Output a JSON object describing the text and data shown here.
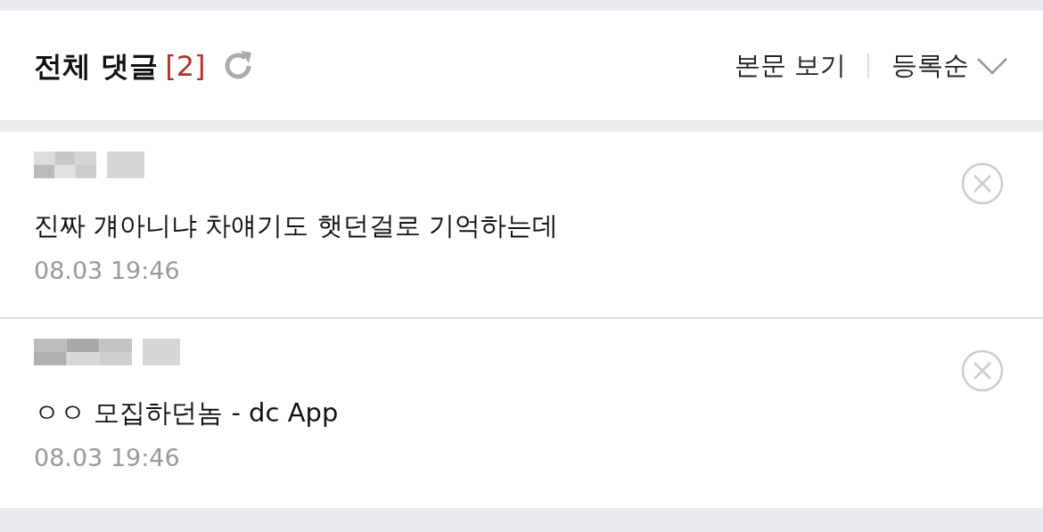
{
  "header": {
    "title": "전체 댓글",
    "count": "[2]",
    "view_post": "본문 보기",
    "sort": "등록순"
  },
  "comments": [
    {
      "text": "진짜 걔아니냐 차얘기도 햇던걸로 기억하는데",
      "time": "08.03 19:46"
    },
    {
      "text": "ㅇㅇ 모집하던놈 - dc App",
      "time": "08.03 19:46"
    }
  ]
}
